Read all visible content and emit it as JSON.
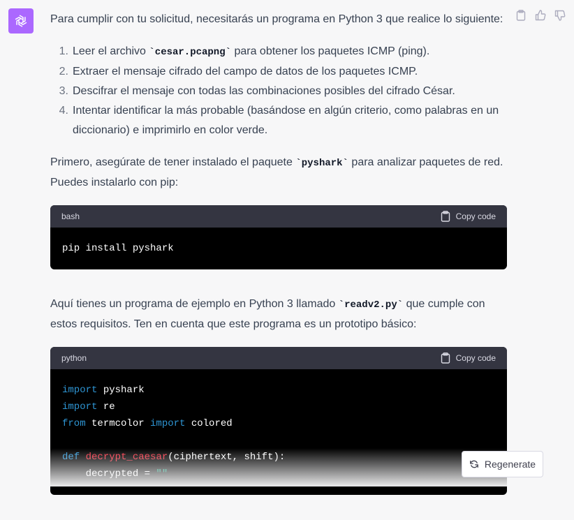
{
  "message": {
    "intro": "Para cumplir con tu solicitud, necesitarás un programa en Python 3 que realice lo siguiente:",
    "steps": [
      {
        "num": "1.",
        "pre": "Leer el archivo ",
        "code": "`cesar.pcapng`",
        "post": " para obtener los paquetes ICMP (ping)."
      },
      {
        "num": "2.",
        "text": "Extraer el mensaje cifrado del campo de datos de los paquetes ICMP."
      },
      {
        "num": "3.",
        "text": "Descifrar el mensaje con todas las combinaciones posibles del cifrado César."
      },
      {
        "num": "4.",
        "text": "Intentar identificar la más probable (basándose en algún criterio, como palabras en un diccionario) e imprimirlo en color verde."
      }
    ],
    "para1": {
      "pre": "Primero, asegúrate de tener instalado el paquete ",
      "code": "`pyshark`",
      "post": " para analizar paquetes de red. Puedes instalarlo con pip:"
    },
    "code1": {
      "lang": "bash",
      "copy_label": "Copy code",
      "line": "pip install pyshark"
    },
    "para2": {
      "pre": "Aquí tienes un programa de ejemplo en Python 3 llamado ",
      "code": "`readv2.py`",
      "post": " que cumple con estos requisitos. Ten en cuenta que este programa es un prototipo básico:"
    },
    "code2": {
      "lang": "python",
      "copy_label": "Copy code",
      "l1_kw": "import",
      "l1_rest": " pyshark",
      "l2_kw": "import",
      "l2_rest": " re",
      "l3_kw1": "from",
      "l3_mid": " termcolor ",
      "l3_kw2": "import",
      "l3_rest": " colored",
      "l5_kw": "def",
      "l5_fn": "decrypt_caesar",
      "l5_rest": "(ciphertext, shift):",
      "l6_pre": "    decrypted = ",
      "l6_str": "\"\""
    }
  },
  "regenerate_label": "Regenerate",
  "icons": {
    "avatar": "openai-logo-icon",
    "copy": "clipboard-icon",
    "like": "thumbs-up-icon",
    "dislike": "thumbs-down-icon",
    "regen": "refresh-icon"
  },
  "colors": {
    "avatar_bg": "#ab68ff",
    "code_bg": "#000000",
    "code_header": "#343541",
    "keyword": "#2e95d3",
    "function": "#f22c3d",
    "string": "#00a67d"
  }
}
